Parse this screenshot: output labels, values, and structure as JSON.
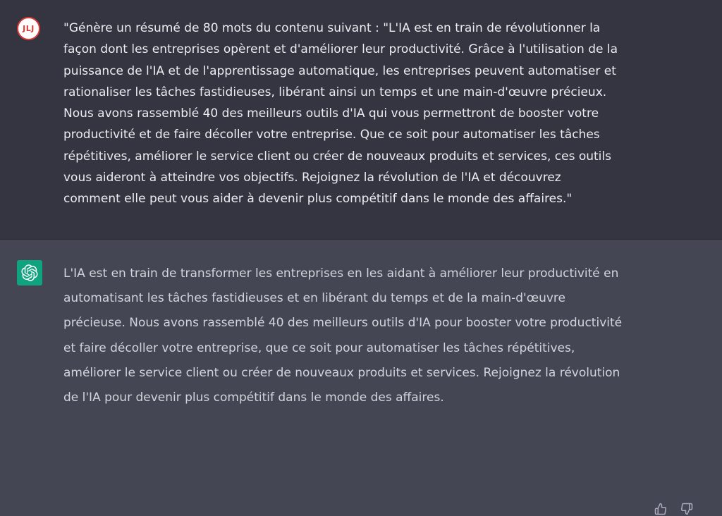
{
  "user": {
    "avatar_initials": "JLJ",
    "message_lines": [
      "\"Génère un résumé de 80 mots du contenu suivant : \"L'IA est en train de révolutionner la",
      "façon dont les entreprises opèrent et d'améliorer leur productivité. Grâce à l'utilisation de la",
      "puissance de l'IA et de l'apprentissage automatique, les entreprises peuvent automatiser et",
      "rationaliser les tâches fastidieuses, libérant ainsi un temps et une main-d'œuvre précieux.",
      "Nous avons rassemblé 40 des meilleurs outils d'IA qui vous permettront de booster votre",
      "productivité et de faire décoller votre entreprise. Que ce soit pour automatiser les tâches",
      "répétitives, améliorer le service client ou créer de nouveaux produits et services, ces outils",
      "vous aideront à atteindre vos objectifs. Rejoignez la révolution de l'IA et découvrez",
      "comment elle peut vous aider à devenir plus compétitif dans le monde des affaires.\""
    ]
  },
  "assistant": {
    "avatar_icon": "openai-logo-icon",
    "message_lines": [
      "L'IA est en train de transformer les entreprises en les aidant à améliorer leur productivité en",
      "automatisant les tâches fastidieuses et en libérant du temps et de la main-d'œuvre",
      "précieuse. Nous avons rassemblé 40 des meilleurs outils d'IA pour booster votre productivité",
      "et faire décoller votre entreprise, que ce soit pour automatiser les tâches répétitives,",
      "améliorer le service client ou créer de nouveaux produits et services. Rejoignez la révolution",
      "de l'IA pour devenir plus compétitif dans le monde des affaires."
    ],
    "actions": {
      "thumbs_up_icon": "thumbs-up-icon",
      "thumbs_down_icon": "thumbs-down-icon"
    }
  },
  "colors": {
    "user_bg": "#343541",
    "assistant_bg": "#444654",
    "text": "#ececf1",
    "avatar_user_border": "#d93a35",
    "avatar_bot_bg": "#10a37f",
    "icon": "#acacbe"
  }
}
